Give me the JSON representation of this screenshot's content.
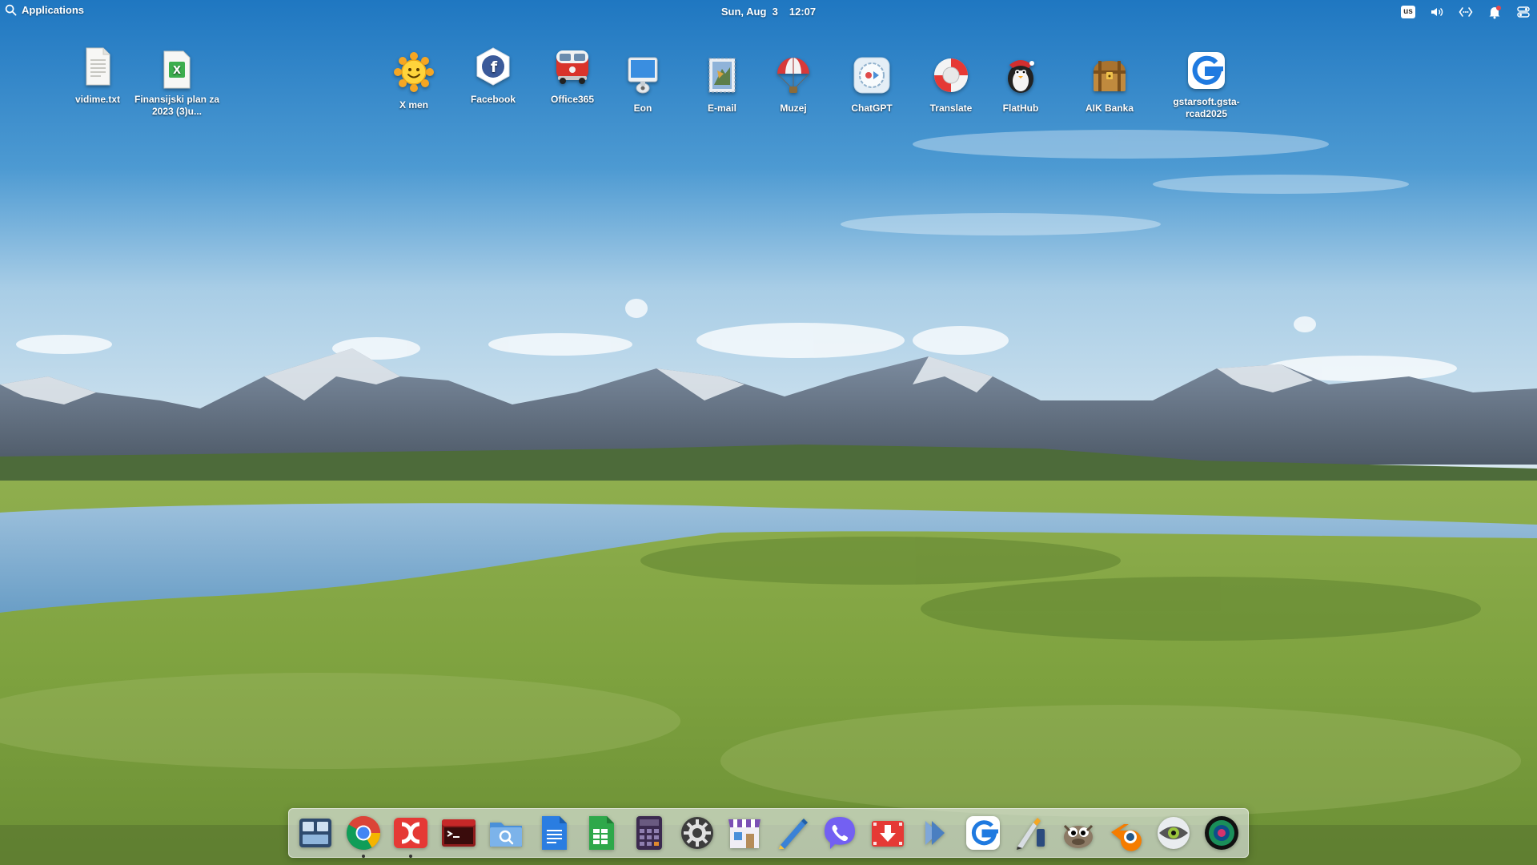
{
  "top_panel": {
    "apps_label": "Applications",
    "date": "Sun, Aug  3",
    "time": "12:07",
    "keyboard_layout": "us"
  },
  "desktop_icons": [
    {
      "label": "vidime.txt",
      "icon": "text-file-icon"
    },
    {
      "label": "Finansijski plan za 2023 (3)u...",
      "icon": "spreadsheet-file-icon"
    },
    {
      "label": "X men",
      "icon": "sun-face-icon"
    },
    {
      "label": "Facebook",
      "icon": "facebook-icon"
    },
    {
      "label": "Office365",
      "icon": "van-icon"
    },
    {
      "label": "Eon",
      "icon": "monitor-icon"
    },
    {
      "label": "E-mail",
      "icon": "stamp-icon"
    },
    {
      "label": "Muzej",
      "icon": "parachute-icon"
    },
    {
      "label": "ChatGPT",
      "icon": "record-icon"
    },
    {
      "label": "Translate",
      "icon": "lifebuoy-icon"
    },
    {
      "label": "FlatHub",
      "icon": "penguin-icon"
    },
    {
      "label": "AIK Banka",
      "icon": "treasure-chest-icon"
    },
    {
      "label": "gstarsoft.gsta-rcad2025",
      "icon": "gstarcad-icon"
    }
  ],
  "dock_items": [
    {
      "name": "multitasking-view-icon",
      "running": false
    },
    {
      "name": "chrome-icon",
      "running": true
    },
    {
      "name": "double-commander-icon",
      "running": true
    },
    {
      "name": "terminal-icon",
      "running": false
    },
    {
      "name": "file-manager-icon",
      "running": false
    },
    {
      "name": "document-writer-icon",
      "running": false
    },
    {
      "name": "spreadsheet-icon",
      "running": false
    },
    {
      "name": "calculator-icon",
      "running": false
    },
    {
      "name": "system-settings-icon",
      "running": false
    },
    {
      "name": "app-store-icon",
      "running": false
    },
    {
      "name": "text-editor-icon",
      "running": false
    },
    {
      "name": "viber-icon",
      "running": false
    },
    {
      "name": "video-downloader-icon",
      "running": false
    },
    {
      "name": "video-player-icon",
      "running": false
    },
    {
      "name": "gstarcad-icon",
      "running": false
    },
    {
      "name": "inkscape-icon",
      "running": false
    },
    {
      "name": "gimp-icon",
      "running": false
    },
    {
      "name": "blender-icon",
      "running": false
    },
    {
      "name": "eye-icon",
      "running": false
    },
    {
      "name": "screen-recorder-icon",
      "running": false
    }
  ],
  "colors": {
    "sky_top": "#2a7dc4",
    "sky_horizon": "#cfe3ef",
    "grass": "#6f9a3c",
    "water": "#7eaccd",
    "dock_bg": "#e8ecf0"
  }
}
